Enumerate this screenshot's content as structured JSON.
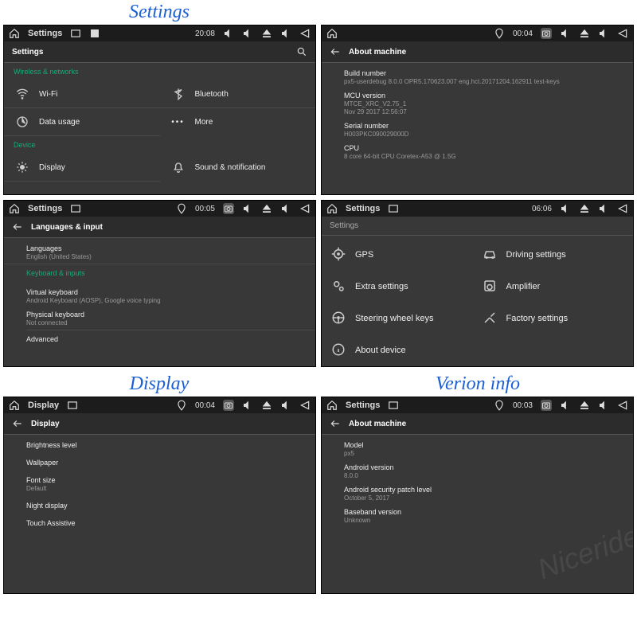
{
  "captions": {
    "settings": "Settings",
    "display": "Display",
    "version": "Verion info"
  },
  "statusbar": {
    "title": "Settings",
    "display_title": "Display"
  },
  "times": {
    "p1": "20:08",
    "p2": "00:04",
    "p3": "00:05",
    "p4": "06:06",
    "p5": "00:04",
    "p6": "00:03"
  },
  "panel1": {
    "header": "Settings",
    "sec1": "Wireless & networks",
    "wifi": "Wi-Fi",
    "bluetooth": "Bluetooth",
    "datausage": "Data usage",
    "more": "More",
    "sec2": "Device",
    "display": "Display",
    "sound": "Sound & notification"
  },
  "panel2": {
    "header": "About machine",
    "build_k": "Build number",
    "build_v": "px5-userdebug 8.0.0 OPR5.170623.007 eng.hct.20171204.162911 test-keys",
    "mcu_k": "MCU version",
    "mcu_v1": "MTCE_XRC_V2.75_1",
    "mcu_v2": "Nov 29 2017 12:56:07",
    "serial_k": "Serial number",
    "serial_v": "H003PKC090029000D",
    "cpu_k": "CPU",
    "cpu_v": "8 core 64-bit CPU Coretex-A53 @ 1.5G"
  },
  "panel3": {
    "header": "Languages & input",
    "lang_k": "Languages",
    "lang_v": "English (United States)",
    "sec": "Keyboard & inputs",
    "vkbd_k": "Virtual keyboard",
    "vkbd_v": "Android Keyboard (AOSP), Google voice typing",
    "pkbd_k": "Physical keyboard",
    "pkbd_v": "Not connected",
    "adv": "Advanced"
  },
  "panel4": {
    "header": "Settings",
    "gps": "GPS",
    "driving": "Driving settings",
    "extra": "Extra settings",
    "amp": "Amplifier",
    "steering": "Steering wheel keys",
    "factory": "Factory settings",
    "about": "About device"
  },
  "panel5": {
    "header": "Display",
    "brightness": "Brightness level",
    "wallpaper": "Wallpaper",
    "fontsize_k": "Font size",
    "fontsize_v": "Default",
    "night": "Night display",
    "touch": "Touch Assistive"
  },
  "panel6": {
    "header": "About machine",
    "model_k": "Model",
    "model_v": "px5",
    "av_k": "Android version",
    "av_v": "8.0.0",
    "patch_k": "Android security patch level",
    "patch_v": "October 5, 2017",
    "bb_k": "Baseband version",
    "bb_v": "Unknown"
  },
  "watermark": "Niceride"
}
